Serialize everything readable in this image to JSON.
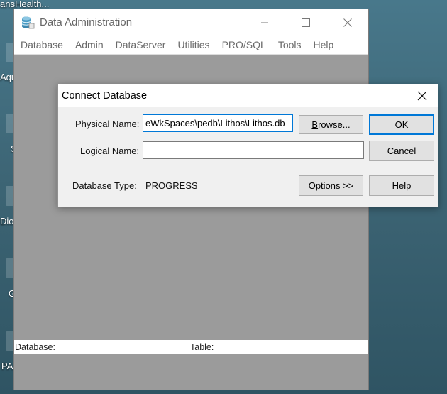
{
  "desktop": {
    "icons": [
      {
        "label": "ansHealth..."
      },
      {
        "label": "Aqu"
      },
      {
        "label": "S"
      },
      {
        "label": "Diox"
      },
      {
        "label": "G"
      },
      {
        "label": "PA"
      }
    ]
  },
  "main_window": {
    "title": "Data Administration",
    "menu": [
      "Database",
      "Admin",
      "DataServer",
      "Utilities",
      "PRO/SQL",
      "Tools",
      "Help"
    ],
    "status": {
      "database_label": "Database:",
      "table_label": "Table:"
    }
  },
  "dialog": {
    "title": "Connect Database",
    "physical_name": {
      "label_pre": "Physical ",
      "label_ul": "N",
      "label_post": "ame:",
      "value": "eWkSpaces\\pedb\\Lithos\\Lithos.db"
    },
    "logical_name": {
      "label_pre": "",
      "label_ul": "L",
      "label_post": "ogical Name:",
      "value": ""
    },
    "database_type": {
      "label": "Database Type:",
      "value": "PROGRESS"
    },
    "buttons": {
      "browse": {
        "pre": "",
        "ul": "B",
        "post": "rowse..."
      },
      "ok": "OK",
      "cancel": "Cancel",
      "options": {
        "pre": "",
        "ul": "O",
        "post": "ptions >>"
      },
      "help": {
        "pre": "",
        "ul": "H",
        "post": "elp"
      }
    }
  }
}
